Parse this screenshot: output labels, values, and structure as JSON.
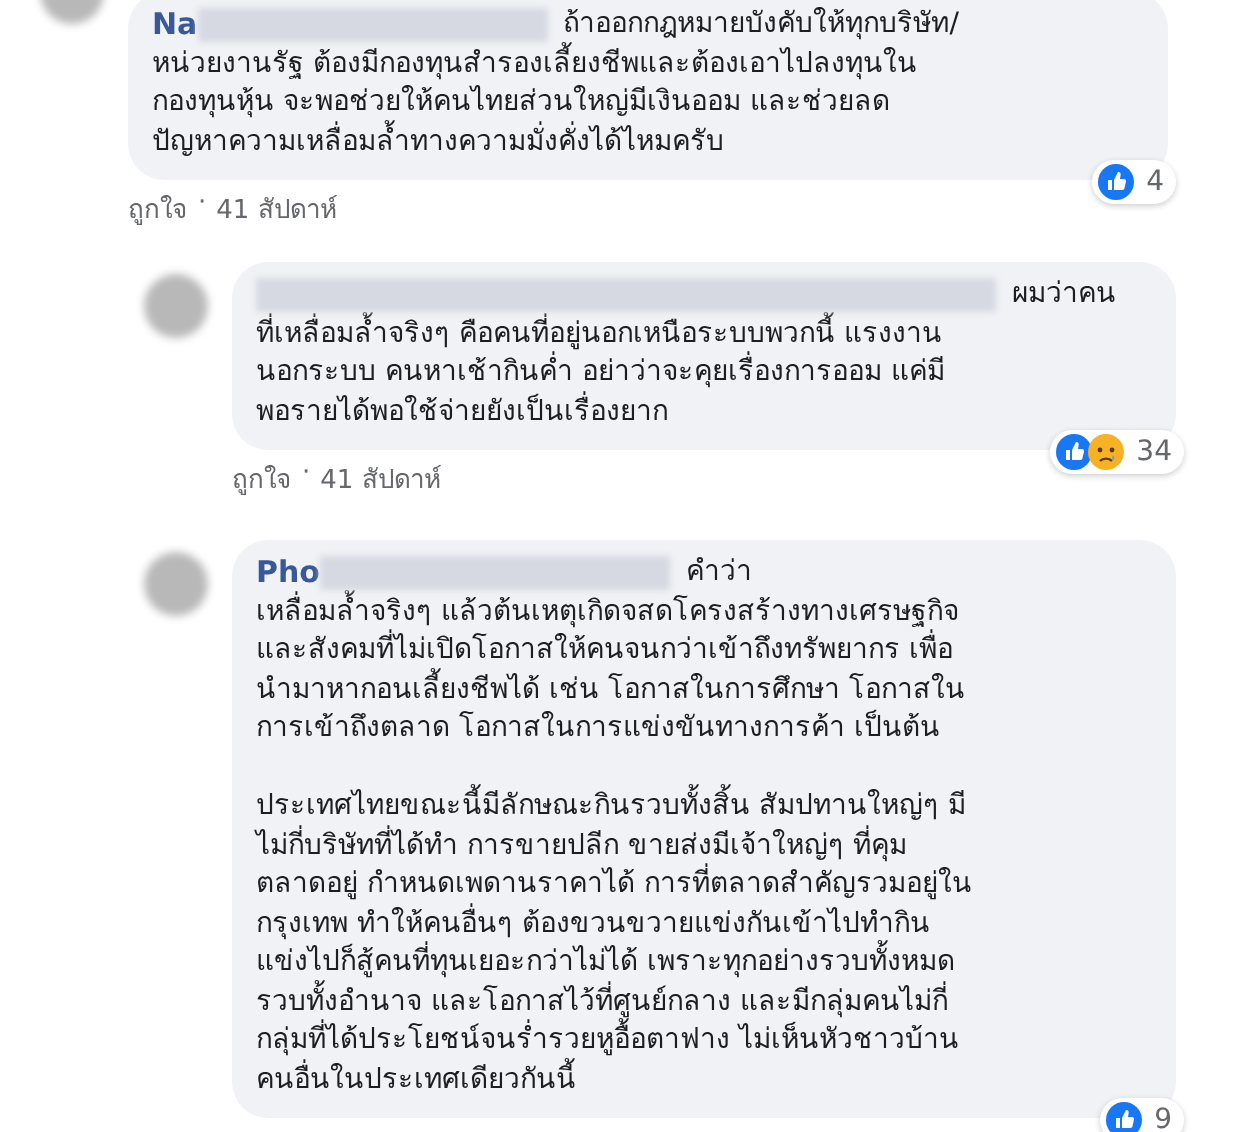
{
  "comments": [
    {
      "reply": false,
      "name": "Na",
      "lead": "ถ้าออกกฎหมายบังคับให้ทุกบริษัท/",
      "text": "หน่วยงานรัฐ ต้องมีกองทุนสำรองเลี้ยงชีพและต้องเอาไปลงทุนใน\nกองทุนหุ้น จะพอช่วยให้คนไทยส่วนใหญ่มีเงินออม และช่วยลด\nปัญหาความเหลื่อมล้ำทางความมั่งคั่งได้ไหมครับ",
      "reactions": [
        {
          "kind": "like"
        }
      ],
      "count": "4",
      "footer": {
        "like": "ถูกใจ",
        "separator": "·",
        "time": "41 สัปดาห์"
      }
    },
    {
      "reply": true,
      "lead": "ผมว่าคน",
      "text": "ที่เหลื่อมล้ำจริงๆ คือคนที่อยู่นอกเหนือระบบพวกนี้ แรงงาน\nนอกระบบ คนหาเช้ากินค่ำ อย่าว่าจะคุยเรื่องการออม แค่มี\nพอรายได้พอใช้จ่ายยังเป็นเรื่องยาก",
      "reactions": [
        {
          "kind": "like"
        },
        {
          "kind": "sad"
        }
      ],
      "count": "34",
      "footer": {
        "like": "ถูกใจ",
        "separator": "·",
        "time": "41 สัปดาห์"
      }
    },
    {
      "reply": true,
      "name": "Pho",
      "lead": "คำว่า",
      "text": "เหลื่อมล้ำจริงๆ แล้วต้นเหตุเกิดจสดโครงสร้างทางเศรษฐกิจ\nและสังคมที่ไม่เปิดโอกาสให้คนจนกว่าเข้าถึงทรัพยากร เพื่อ\nนำมาหากอนเลี้ยงชีพได้ เช่น โอกาสในการศึกษา โอกาสใน\nการเข้าถึงตลาด โอกาสในการแข่งขันทางการค้า เป็นต้น\n\nประเทศไทยขณะนี้มีลักษณะกินรวบทั้งสิ้น สัมปทานใหญ่ๆ มี\nไม่กี่บริษัทที่ได้ทำ การขายปลีก ขายส่งมีเจ้าใหญ่ๆ ที่คุม\nตลาดอยู่ กำหนดเพดานราคาได้ การที่ตลาดสำคัญรวมอยู่ใน\nกรุงเทพ ทำให้คนอื่นๆ ต้องขวนขวายแข่งกันเข้าไปทำกิน\nแข่งไปก็สู้คนที่ทุนเยอะกว่าไม่ได้ เพราะทุกอย่างรวบทั้งหมด\nรวบทั้งอำนาจ และโอกาสไว้ที่ศูนย์กลาง และมีกลุ่มคนไม่กี่\nกลุ่มที่ได้ประโยชน์จนร่ำรวยหูอื้อตาฟาง ไม่เห็นหัวชาวบ้าน\nคนอื่นในประเทศเดียวกันนี้",
      "reactions": [
        {
          "kind": "like"
        }
      ],
      "count": "9"
    }
  ]
}
